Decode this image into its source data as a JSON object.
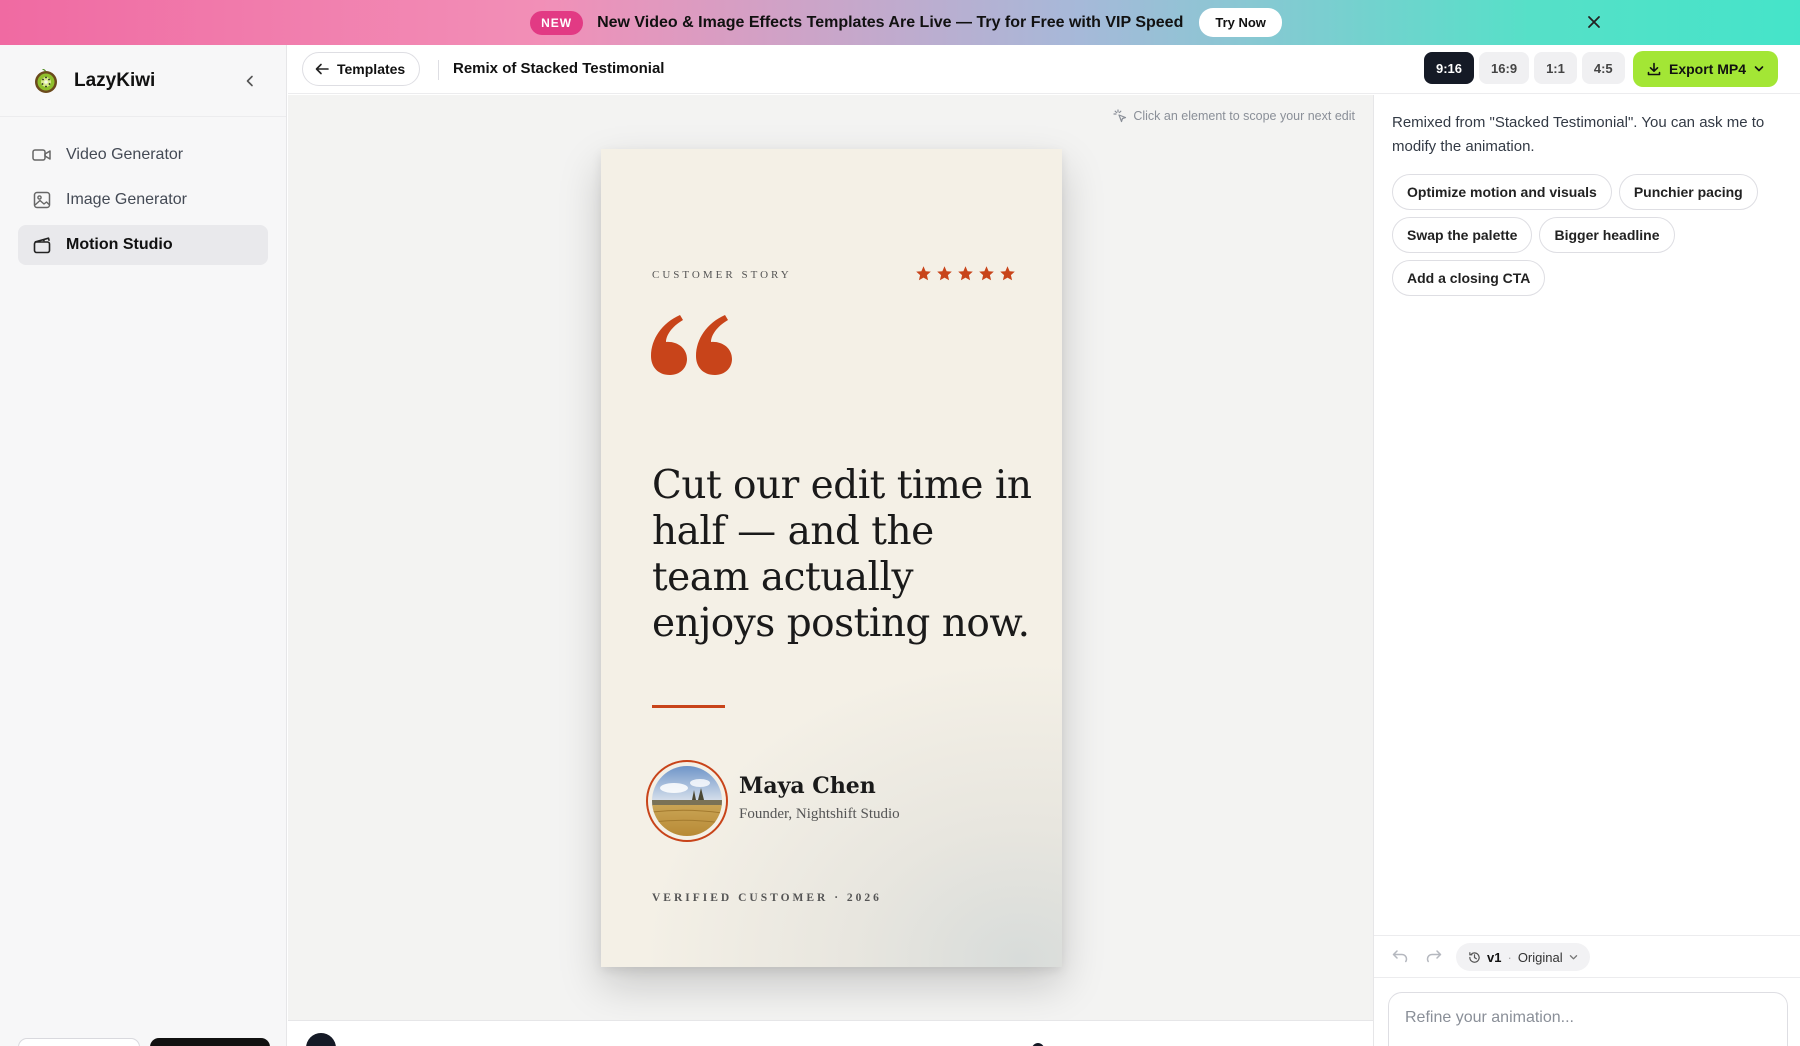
{
  "banner": {
    "badge": "NEW",
    "text_main": "New Video & Image Effects Templates Are Live — Try for Free with ",
    "text_bold": "VIP Speed",
    "cta": "Try Now",
    "gradient_start": "#f06aa2",
    "gradient_end": "#45e4c9",
    "close_icon": "close-icon"
  },
  "sidebar": {
    "brand": "LazyKiwi",
    "items": [
      {
        "label": "Video Generator",
        "icon": "video-camera-icon",
        "active": false
      },
      {
        "label": "Image Generator",
        "icon": "image-icon",
        "active": false
      },
      {
        "label": "Motion Studio",
        "icon": "clapperboard-icon",
        "active": true
      }
    ]
  },
  "header": {
    "back_label": "Templates",
    "title": "Remix of Stacked Testimonial",
    "ratios": [
      {
        "label": "9:16",
        "active": true
      },
      {
        "label": "16:9",
        "active": false
      },
      {
        "label": "1:1",
        "active": false
      },
      {
        "label": "4:5",
        "active": false
      }
    ],
    "export_label": "Export MP4",
    "export_color": "#a3e635"
  },
  "canvas": {
    "hint": "Click an element to scope your next edit",
    "card": {
      "eyebrow": "CUSTOMER STORY",
      "rating": 5,
      "quote": "Cut our edit time in half — and the team actually enjoys posting now.",
      "name": "Maya Chen",
      "role": "Founder, Nightshift Studio",
      "footer": "VERIFIED CUSTOMER · 2026",
      "accent_color": "#c8441a",
      "background": "#f4f0e6"
    }
  },
  "panel": {
    "message": "Remixed from \"Stacked Testimonial\". You can ask me to modify the animation.",
    "suggestions": [
      "Optimize motion and visuals",
      "Punchier pacing",
      "Swap the palette",
      "Bigger headline",
      "Add a closing CTA"
    ],
    "version": "v1",
    "version_name": "Original",
    "refine_placeholder": "Refine your animation..."
  }
}
